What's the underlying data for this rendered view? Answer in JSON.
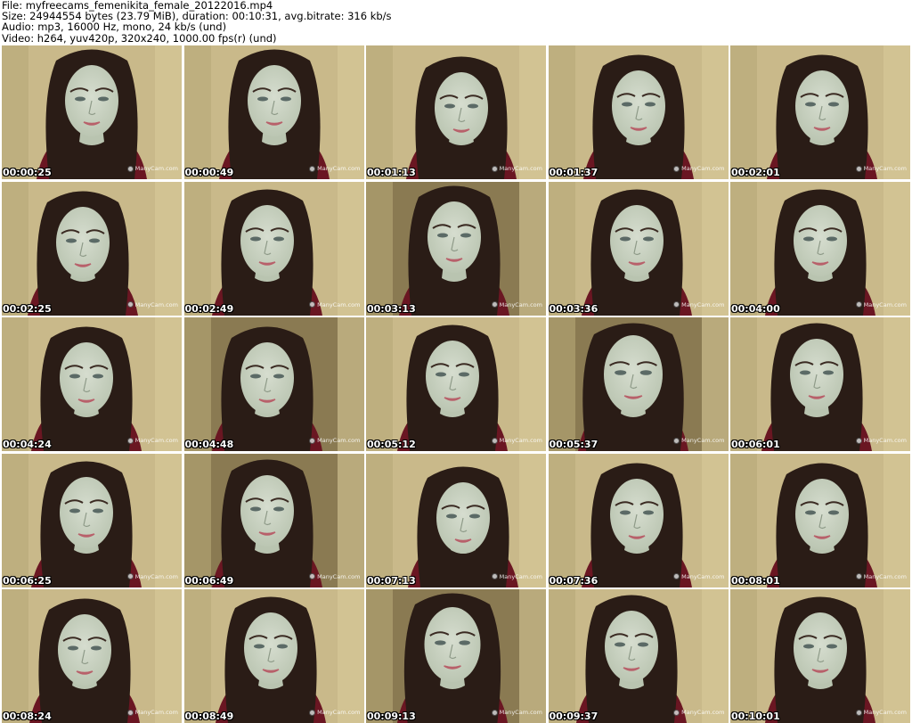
{
  "header": {
    "file": "File: myfreecams_femenikita_female_20122016.mp4",
    "size": "Size: 24944554 bytes (23.79 MiB), duration: 00:10:31, avg.bitrate: 316 kb/s",
    "audio": "Audio: mp3, 16000 Hz, mono, 24 kb/s (und)",
    "video": "Video: h264, yuv420p, 320x240, 1000.00 fps(r) (und)"
  },
  "watermark": "ManyCam.com",
  "thumbnails": [
    {
      "time": "00:00:25"
    },
    {
      "time": "00:00:49"
    },
    {
      "time": "00:01:13"
    },
    {
      "time": "00:01:37"
    },
    {
      "time": "00:02:01"
    },
    {
      "time": "00:02:25"
    },
    {
      "time": "00:02:49"
    },
    {
      "time": "00:03:13"
    },
    {
      "time": "00:03:36"
    },
    {
      "time": "00:04:00"
    },
    {
      "time": "00:04:24"
    },
    {
      "time": "00:04:48"
    },
    {
      "time": "00:05:12"
    },
    {
      "time": "00:05:37"
    },
    {
      "time": "00:06:01"
    },
    {
      "time": "00:06:25"
    },
    {
      "time": "00:06:49"
    },
    {
      "time": "00:07:13"
    },
    {
      "time": "00:07:36"
    },
    {
      "time": "00:08:01"
    },
    {
      "time": "00:08:24"
    },
    {
      "time": "00:08:49"
    },
    {
      "time": "00:09:13"
    },
    {
      "time": "00:09:37"
    },
    {
      "time": "00:10:01"
    }
  ],
  "colors": {
    "wall": "#c9b98a",
    "wall_dark": "#8a7a52",
    "hair": "#2a1c16",
    "skin": "#b9c4b0",
    "shirt": "#6a1622",
    "lips": "#b8606a"
  }
}
